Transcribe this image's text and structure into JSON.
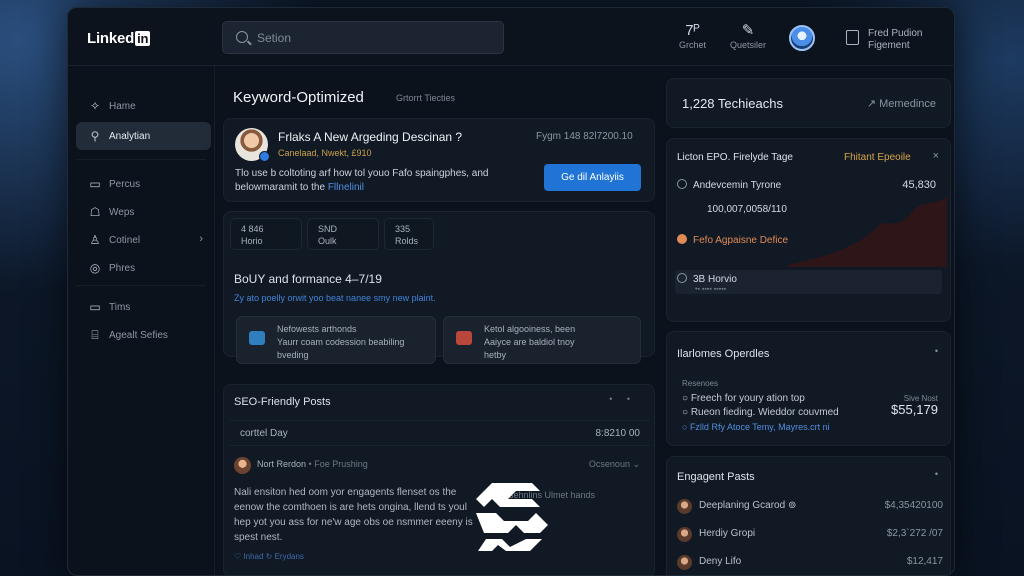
{
  "colors": {
    "accent": "#1f74d6",
    "gold": "#d6a54a",
    "background": "#0c121b"
  },
  "topbar": {
    "logo_text": "Linked",
    "logo_in": "in",
    "search_placeholder": "Setion",
    "nav": [
      {
        "glyph": "7ᴾ",
        "label": "Grchet",
        "icon": "network-icon"
      },
      {
        "glyph": "✎",
        "label": "Quetsiler",
        "icon": "pen-icon"
      }
    ],
    "menu_label_1": "Fred Pudion",
    "menu_label_2": "Figement"
  },
  "sidebar": {
    "items": [
      {
        "icon": "✧",
        "label": "Hame",
        "active": false
      },
      {
        "icon": "⚲",
        "label": "Analytian",
        "active": true
      },
      {
        "icon": "▭",
        "label": "Percus",
        "active": false
      },
      {
        "icon": "☖",
        "label": "Weps",
        "active": false
      },
      {
        "icon": "♙",
        "label": "Cotinel",
        "active": false,
        "chevron": "›"
      },
      {
        "icon": "◎",
        "label": "Phres",
        "active": false
      },
      {
        "icon": "▭",
        "label": "Tims",
        "active": false
      },
      {
        "icon": "⌸",
        "label": "Agealt Sefies",
        "active": false
      }
    ]
  },
  "main": {
    "title": "Keyword-Optimized",
    "title_sub": "Grtorrt Tiecties",
    "card1": {
      "headline": "Frlaks A New Argeding Descinan ?",
      "subline": "Canelaad, Nwekt, £910",
      "meta": "Fygm 148 82l7200.10",
      "body": "Tlo use b coltoting arf how tol youo Fafo spaingphes, and belowmaramit to the ",
      "body_link": "Fllnelinil",
      "button": "Ge dil Anlayiis"
    },
    "stats": [
      {
        "value": "4 846",
        "label": "Horio"
      },
      {
        "value": "SND",
        "label": "Oulk"
      },
      {
        "value": "335",
        "label": "Rolds"
      }
    ],
    "perf": {
      "title": "BoUY and formance 4–7/19",
      "title_num": "19",
      "link": "Zy ato poelly orwit yoo beat nanee smy new plaint."
    },
    "subcards": [
      {
        "icon": "chart-icon",
        "line1": "Nefowests arthonds",
        "line2": "Yaurr coam codession beabiling",
        "line3": "bveding"
      },
      {
        "icon": "tools-icon",
        "line1": "Ketol algooiness, been",
        "line2": "Aaiyce are baldiol tnoy",
        "line3": "hetby"
      }
    ],
    "seo": {
      "title": "SEO-Friendly Posts",
      "dots": "• •",
      "row_left": "corttel Day",
      "row_right": "8:8210 00",
      "author": "Nort Rerdon",
      "author_tag": "• Foe Prushing",
      "reply": "Ocsenoun ⌄",
      "body": "Nali ensiton hed oom yor engagents flenset os the eenow the comthoen is are hets ongina, llend ts youl hep yot you ass for ne'w age obs oe nsmmer eeeny is spest nest.",
      "side": "Sert sehnlins Ulmet hands",
      "footer": "♡ Inhad  ↻ Erydans"
    }
  },
  "right": {
    "summary": {
      "count": "1,228 Techieachs",
      "trend": "Memedince"
    },
    "lead": {
      "title": "Licton EPO. Firelyde Tage",
      "tag": "Fhitant Epeoile",
      "close": "×",
      "row1": "Andevcemin Tyrone",
      "row1_value": "45,830",
      "row2": "100,007,0058/110",
      "row3": "Fefo Agpaisne Defice",
      "row4": "3B Horvio",
      "row4_sub": "•▪ ▪▪▪▪ ▪▪▪▪▪"
    },
    "opps": {
      "title": "Ilarlomes Operdles",
      "dot": "•",
      "label": "Resenoes",
      "lines": [
        "Freech for youry ation top",
        "Rueon fieding. Wieddor couvmed",
        "Fzlld Rfy Atoce Temy, Mayres.crt ni"
      ],
      "right_small": "Sive Nost",
      "right_big": "$55,179"
    },
    "engaged": {
      "title": "Engagent Pasts",
      "dot": "•",
      "items": [
        {
          "name": "Deeplaning Gcarod ⊚",
          "value": "$4,35420100"
        },
        {
          "name": "Herdiy Gropi",
          "value": "$2,3`272 /07"
        },
        {
          "name": "Deny Lifo",
          "value": "$12,417"
        }
      ]
    }
  }
}
